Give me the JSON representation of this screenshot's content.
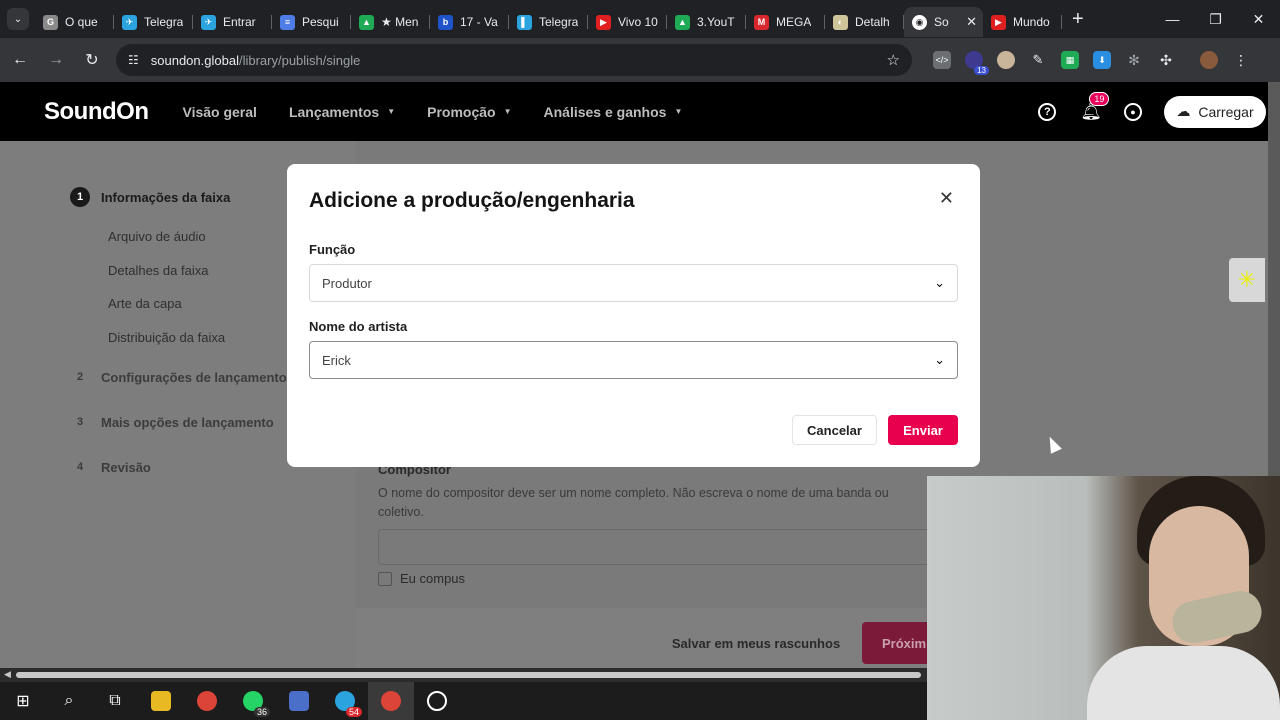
{
  "browser": {
    "tabs": [
      {
        "label": "O que",
        "color": "#8a8a8a",
        "glyph": "G"
      },
      {
        "label": "Telegra",
        "color": "#2aa3df",
        "glyph": "✈"
      },
      {
        "label": "Entrar",
        "color": "#2aa3df",
        "glyph": "✈"
      },
      {
        "label": "Pesqui",
        "color": "#4f7de8",
        "glyph": "≡"
      },
      {
        "label": "★ Men",
        "color": "#1faa55",
        "glyph": "▲"
      },
      {
        "label": "17 - Va",
        "color": "#1f53c9",
        "glyph": "b"
      },
      {
        "label": "Telegra",
        "color": "#2aa3df",
        "glyph": "▌"
      },
      {
        "label": "Vivo 10",
        "color": "#e02020",
        "glyph": "▶"
      },
      {
        "label": "3.YouT",
        "color": "#1faa55",
        "glyph": "▲"
      },
      {
        "label": "MEGA",
        "color": "#d9272e",
        "glyph": "M"
      },
      {
        "label": "Detalh",
        "color": "#cfc59a",
        "glyph": "◐"
      },
      {
        "label": "So",
        "color": "#ffffff",
        "glyph": "◉"
      },
      {
        "label": "Mundo",
        "color": "#e02020",
        "glyph": "▶"
      }
    ],
    "active_tab_index": 11,
    "url_host": "soundon.global",
    "url_path": "/library/publish/single",
    "extension_badge": "13"
  },
  "app": {
    "logo": "SoundOn",
    "nav": [
      {
        "label": "Visão geral",
        "caret": false
      },
      {
        "label": "Lançamentos",
        "caret": true
      },
      {
        "label": "Promoção",
        "caret": true
      },
      {
        "label": "Análises e ganhos",
        "caret": true
      }
    ],
    "notifications_count": "19",
    "upload_label": "Carregar"
  },
  "sidebar": {
    "steps": [
      {
        "num": "1",
        "label": "Informações da faixa",
        "active": true
      },
      {
        "num": "2",
        "label": "Configurações de lançamento",
        "active": false
      },
      {
        "num": "3",
        "label": "Mais opções de lançamento",
        "active": false
      },
      {
        "num": "4",
        "label": "Revisão",
        "active": false
      }
    ],
    "substeps": [
      "Arquivo de áudio",
      "Detalhes da faixa",
      "Arte da capa",
      "Distribuição da faixa"
    ]
  },
  "background_form": {
    "composer_label": "Compositor",
    "composer_help": "O nome do compositor deve ser um nome completo. Não escreva o nome de uma banda ou coletivo.",
    "checkbox_label": "Eu compus",
    "save_draft": "Salvar em meus rascunhos",
    "next": "Próxim"
  },
  "modal": {
    "title": "Adicione a produção/engenharia",
    "role_label": "Função",
    "role_value": "Produtor",
    "artist_label": "Nome do artista",
    "artist_value": "Erick",
    "cancel": "Cancelar",
    "submit": "Enviar"
  },
  "taskbar": {
    "whatsapp_badge": "36",
    "telegram_badge": "54"
  }
}
